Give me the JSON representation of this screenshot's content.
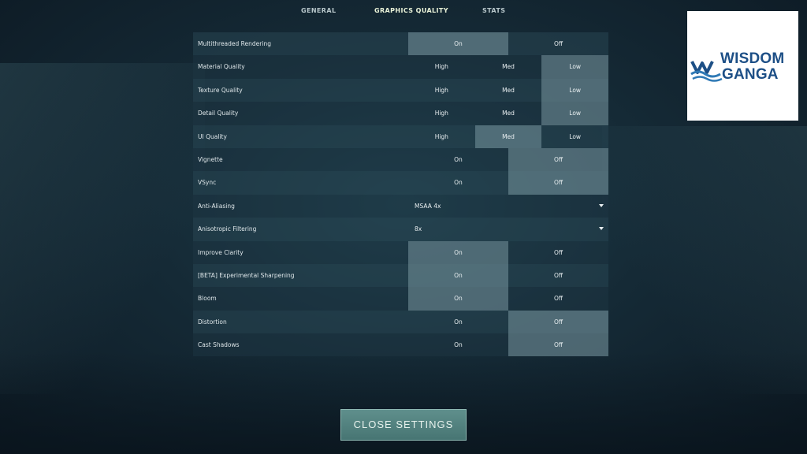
{
  "tabs": [
    {
      "label": "GENERAL"
    },
    {
      "label": "GRAPHICS QUALITY",
      "active": true
    },
    {
      "label": "STATS"
    }
  ],
  "settings": [
    {
      "label": "Multithreaded Rendering",
      "options": [
        "On",
        "Off"
      ],
      "selected": "On"
    },
    {
      "label": "Material Quality",
      "options": [
        "High",
        "Med",
        "Low"
      ],
      "selected": "Low"
    },
    {
      "label": "Texture Quality",
      "options": [
        "High",
        "Med",
        "Low"
      ],
      "selected": "Low"
    },
    {
      "label": "Detail Quality",
      "options": [
        "High",
        "Med",
        "Low"
      ],
      "selected": "Low"
    },
    {
      "label": "UI Quality",
      "options": [
        "High",
        "Med",
        "Low"
      ],
      "selected": "Med"
    },
    {
      "label": "Vignette",
      "options": [
        "On",
        "Off"
      ],
      "selected": "Off"
    },
    {
      "label": "VSync",
      "options": [
        "On",
        "Off"
      ],
      "selected": "Off"
    },
    {
      "label": "Anti-Aliasing",
      "dropdown": "MSAA 4x"
    },
    {
      "label": "Anisotropic Filtering",
      "dropdown": "8x"
    },
    {
      "label": "Improve Clarity",
      "options": [
        "On",
        "Off"
      ],
      "selected": "On"
    },
    {
      "label": "[BETA] Experimental Sharpening",
      "options": [
        "On",
        "Off"
      ],
      "selected": "On"
    },
    {
      "label": "Bloom",
      "options": [
        "On",
        "Off"
      ],
      "selected": "On"
    },
    {
      "label": "Distortion",
      "options": [
        "On",
        "Off"
      ],
      "selected": "Off"
    },
    {
      "label": "Cast Shadows",
      "options": [
        "On",
        "Off"
      ],
      "selected": "Off"
    }
  ],
  "logo": {
    "line1": "WISDOM",
    "line2": "GANGA",
    "color": "#1d4f86"
  },
  "close_button": {
    "label": "CLOSE SETTINGS"
  },
  "colors": {
    "accent": "#5f8f8c",
    "selected_option": "#788f96"
  }
}
